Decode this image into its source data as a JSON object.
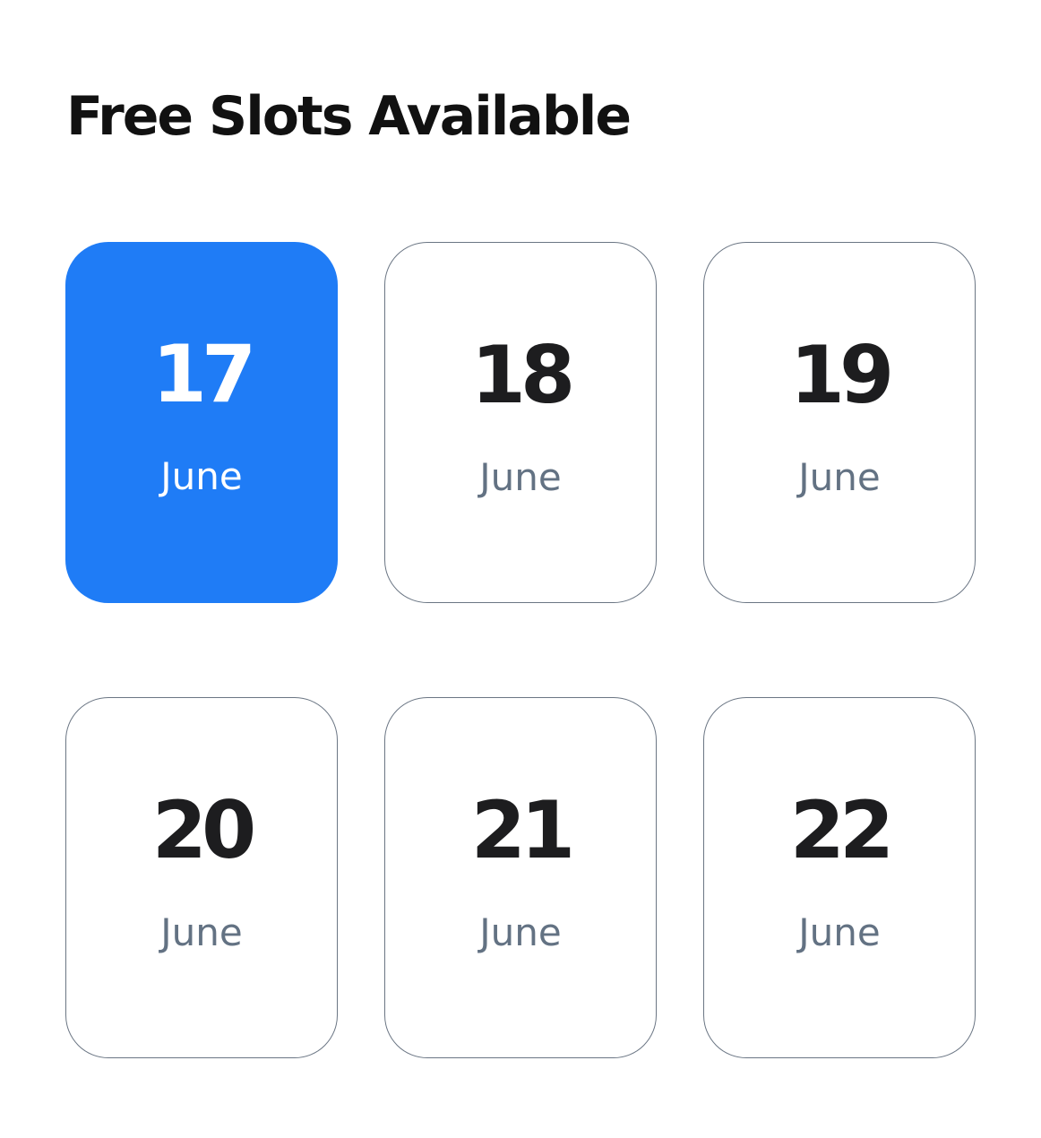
{
  "title": "Free Slots Available",
  "colors": {
    "selected_bg": "#1f7cf6",
    "card_border": "#6b7684",
    "day_text": "#1d1d1f",
    "month_text": "#637283"
  },
  "slots": [
    {
      "day": "17",
      "month": "June",
      "selected": true
    },
    {
      "day": "18",
      "month": "June",
      "selected": false
    },
    {
      "day": "19",
      "month": "June",
      "selected": false
    },
    {
      "day": "20",
      "month": "June",
      "selected": false
    },
    {
      "day": "21",
      "month": "June",
      "selected": false
    },
    {
      "day": "22",
      "month": "June",
      "selected": false
    }
  ]
}
